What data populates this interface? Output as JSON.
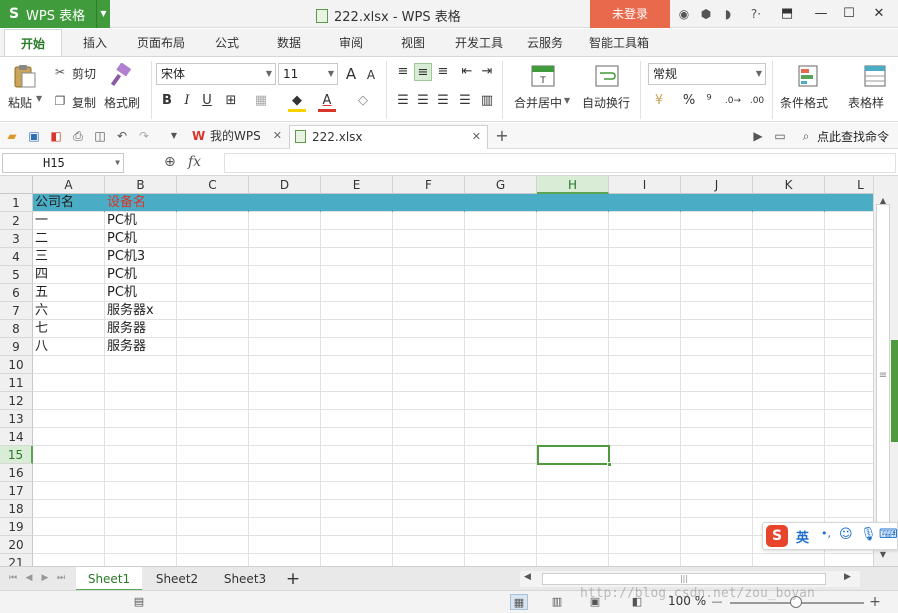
{
  "titlebar": {
    "app_logo": "S",
    "app_name": "WPS 表格",
    "document_title": "222.xlsx - WPS 表格",
    "login_label": "未登录",
    "icons": [
      "skin-icon",
      "cube-icon",
      "share-icon",
      "help-icon"
    ],
    "help_label": "?·",
    "minimize": "—",
    "maximize": "☐",
    "close": "✕"
  },
  "ribbon_tabs": [
    "开始",
    "插入",
    "页面布局",
    "公式",
    "数据",
    "审阅",
    "视图",
    "开发工具",
    "云服务",
    "智能工具箱"
  ],
  "ribbon": {
    "paste_label": "粘贴",
    "cut_label": "剪切",
    "copy_label": "复制",
    "format_painter_label": "格式刷",
    "font_name": "宋体",
    "font_size": "11",
    "bold": "B",
    "italic": "I",
    "underline": "U",
    "grow_font": "A",
    "shrink_font": "A",
    "merge_center_label": "合并居中",
    "wrap_text_label": "自动换行",
    "number_format": "常规",
    "percent": "%",
    "comma": "⁹",
    "conditional_format_label": "条件格式",
    "table_style_label": "表格样"
  },
  "quick_access": {
    "doc_tabs": [
      {
        "label": "我的WPS",
        "active": false
      },
      {
        "label": "222.xlsx",
        "active": true
      }
    ],
    "add_tab": "+",
    "find_label": "点此查找命令"
  },
  "formula_bar": {
    "name_box": "H15",
    "fx": "fx",
    "value": ""
  },
  "sheet": {
    "columns": [
      "A",
      "B",
      "C",
      "D",
      "E",
      "F",
      "G",
      "H",
      "I",
      "J",
      "K",
      "L"
    ],
    "selected_column": "H",
    "selected_row": 15,
    "row_count": 21,
    "header_fill": "#4bacc6",
    "header_red": "#d8352a",
    "rows": [
      [
        "公司名",
        "设备名"
      ],
      [
        "一",
        "PC机"
      ],
      [
        "二",
        "PC机"
      ],
      [
        "三",
        "PC机3"
      ],
      [
        "四",
        "PC机"
      ],
      [
        "五",
        "PC机"
      ],
      [
        "六",
        "服务器x"
      ],
      [
        "七",
        "服务器"
      ],
      [
        "八",
        "服务器"
      ]
    ]
  },
  "sheet_tabs": [
    {
      "label": "Sheet1",
      "active": true
    },
    {
      "label": "Sheet2",
      "active": false
    },
    {
      "label": "Sheet3",
      "active": false
    }
  ],
  "add_sheet": "+",
  "status": {
    "zoom": "100 %",
    "zoom_minus": "—",
    "zoom_plus": "+",
    "watermark": "http://blog.csdn.net/zou_boyan"
  },
  "ime": {
    "logo": "S",
    "lang": "英",
    "punct": "•,"
  },
  "accent_green": "#3f9b3c",
  "accent_orange": "#e9694c"
}
